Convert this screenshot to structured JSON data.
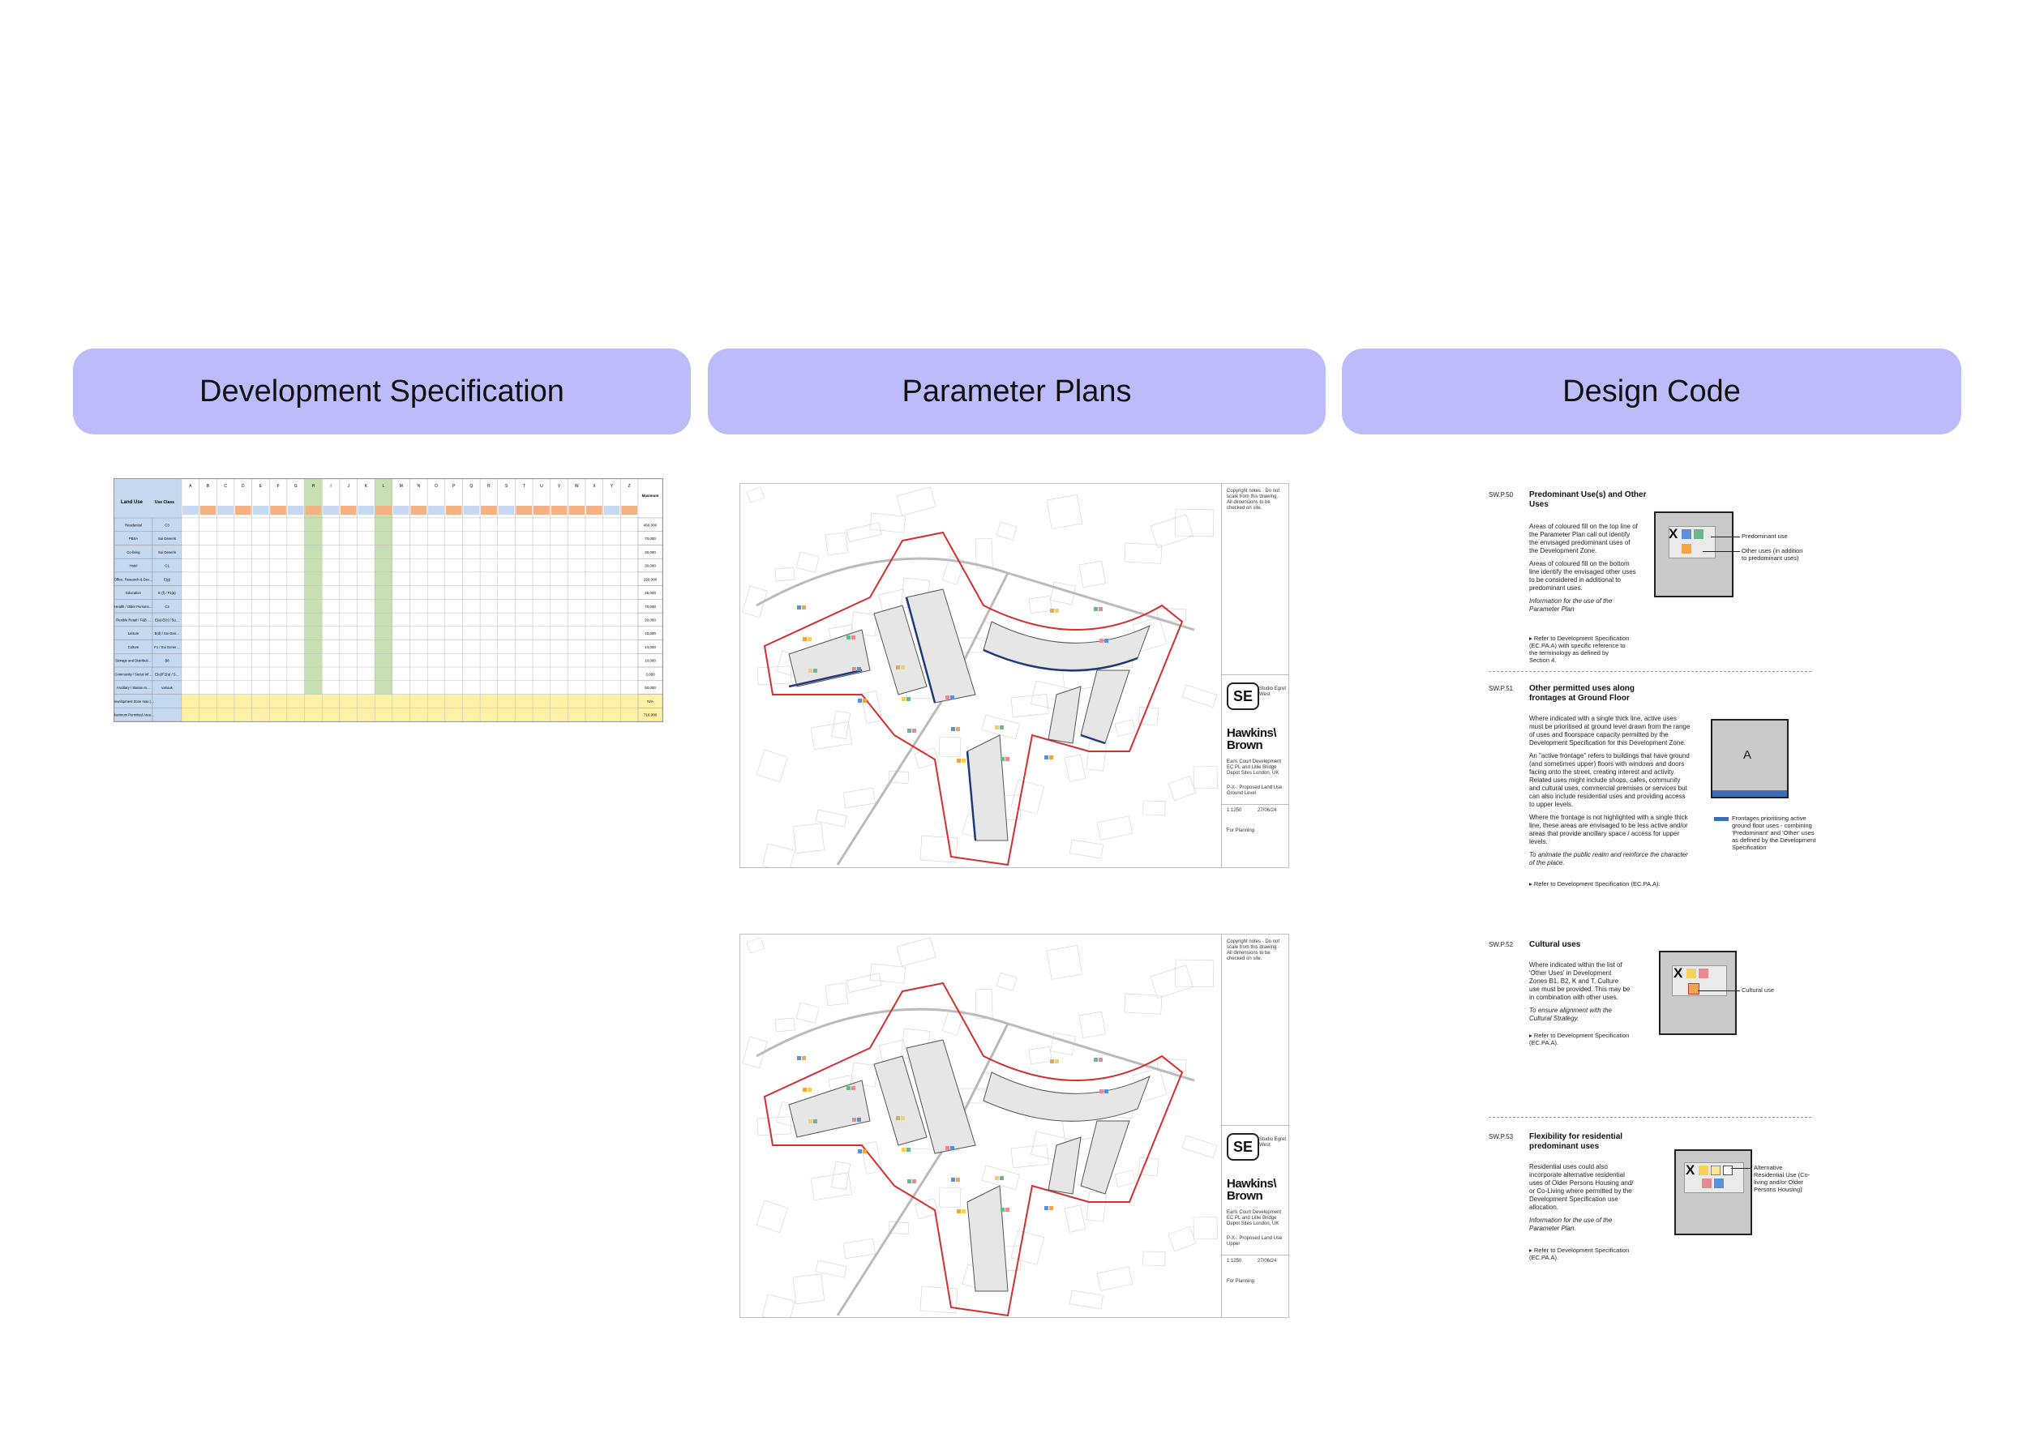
{
  "headers": {
    "development_specification": "Development Specification",
    "parameter_plans": "Parameter Plans",
    "design_code": "Design Code"
  },
  "spec_table": {
    "land_use_header": "Land Use",
    "use_class_header": "Use Class",
    "max_header": "Maximum Permitted Area (sqm GEA)",
    "zones": [
      "A",
      "B",
      "C",
      "D",
      "E",
      "F",
      "G",
      "H",
      "I",
      "J",
      "K",
      "L",
      "M",
      "N",
      "O",
      "P",
      "Q",
      "R",
      "S",
      "T",
      "U",
      "V",
      "W",
      "X",
      "Y",
      "Z"
    ],
    "rows": [
      {
        "use": "Residential",
        "cls": "C3",
        "max": "460,000"
      },
      {
        "use": "PBSA",
        "cls": "Sui Generis",
        "max": "70,000"
      },
      {
        "use": "Co-living",
        "cls": "Sui Generis",
        "max": "30,000"
      },
      {
        "use": "Hotel",
        "cls": "C1",
        "max": "30,000"
      },
      {
        "use": "Office, Research & Development",
        "cls": "E(g)",
        "max": "250,000"
      },
      {
        "use": "Education",
        "cls": "E (f) / F1(a)",
        "max": "45,000"
      },
      {
        "use": "Health / Older Persons Housing",
        "cls": "C2",
        "max": "70,000"
      },
      {
        "use": "Flexible Retail / F&B / Commercial",
        "cls": "E(a)-E(c) / Sui Generis",
        "max": "20,000"
      },
      {
        "use": "Leisure",
        "cls": "E(d) / Sui Generis",
        "max": "10,000"
      },
      {
        "use": "Culture",
        "cls": "F1 / Sui Generis",
        "max": "14,000"
      },
      {
        "use": "Storage and Distribution",
        "cls": "B8",
        "max": "10,000"
      },
      {
        "use": "Community / Social Infrastructure",
        "cls": "E(e)/F2(a) / Sui Generis",
        "max": "3,000"
      },
      {
        "use": "Ancillary / Station Interface / Plant / Parking / Servicing / Earth",
        "cls": "various",
        "max": "50,000"
      },
      {
        "use": "Development Zone max (sqm GEA)",
        "cls": "",
        "max": "N/A"
      },
      {
        "use": "Maximum Permitted Area (sqm GEA)",
        "cls": "",
        "max": "710,000"
      }
    ]
  },
  "plans": [
    {
      "brand": "Hawkins\\ Brown",
      "studio": "Studio Egret West",
      "project": "Earls Court Development EC PL and Lillie Bridge Depot Sites London, UK",
      "drawing": "P-X-: Proposed Land Use Ground Level",
      "scale": "1:1250",
      "date": "27/06/24",
      "status": "For Planning"
    },
    {
      "brand": "Hawkins\\ Brown",
      "studio": "Studio Egret West",
      "project": "Earls Court Development EC PL and Lillie Bridge Depot Sites London, UK",
      "drawing": "P-X-: Proposed Land Use Upper",
      "scale": "1:1250",
      "date": "27/06/24",
      "status": "For Planning"
    }
  ],
  "design_code": [
    {
      "code": "SW.P.50",
      "title": "Predominant Use(s) and Other Uses",
      "body": [
        "Areas of coloured fill on the top line of the Parameter Plan call out identify the envisaged predominant uses of the Development Zone.",
        "Areas of coloured fill on the bottom line identify the envisaged other uses to be considered in additional to predominant uses."
      ],
      "italic": "Information for the use of the Parameter Plan",
      "ref": "Refer to Development Specification (EC.PA.A) with specific reference to the terminology as defined by Section 4.",
      "notes": [
        "Predominant use",
        "Other uses (in addition to predominant uses)"
      ],
      "glyph": "X"
    },
    {
      "code": "SW.P.51",
      "title": "Other permitted uses along frontages at Ground Floor",
      "body": [
        "Where indicated with a single thick line, active uses must be prioritised at ground level drawn from the range of uses and floorspace capacity permitted by the Development Specification for this Development Zone.",
        "An \"active frontage\" refers to buildings that have ground (and sometimes upper) floors with windows and doors facing onto the street, creating interest and activity. Related uses might include shops, cafes, community and cultural uses, commercial premises or services but can also include residential uses and providing access to upper levels.",
        "Where the frontage is not highlighted with a single thick line, these areas are envisaged to be less active and/or areas that provide ancillary space / access for upper levels."
      ],
      "italic": "To animate the public realm and reinforce the character of the place.",
      "ref": "Refer to Development Specification (EC.PA.A).",
      "notes": [
        "Frontages prioritising active ground floor uses - combining 'Predominant' and 'Other' uses as defined by the Development Specification"
      ],
      "glyph": "A"
    },
    {
      "code": "SW.P.52",
      "title": "Cultural uses",
      "body": [
        "Where indicated within the list of 'Other Uses' in Development Zones B1, B2, K and T, Culture use must be provided. This may be in combination with other uses."
      ],
      "italic": "To ensure alignment with the Cultural Strategy.",
      "ref": "Refer to Development Specification (EC.PA.A).",
      "notes": [
        "Cultural use"
      ],
      "glyph": "X"
    },
    {
      "code": "SW.P.53",
      "title": "Flexibility for residential predominant uses",
      "body": [
        "Residential uses could also incorporate alternative residential uses of Older Persons Housing and/ or Co-Living where permitted by the Development Specification use allocation."
      ],
      "italic": "Information for the use of the Parameter Plan.",
      "ref": "Refer to Development Specification (EC.PA.A).",
      "notes": [
        "Alternative Residential Use (Co-living and/or Older Persons Housing)"
      ],
      "glyph": "X"
    }
  ],
  "colors": {
    "header_bg": "#bcbcfb",
    "table_blue": "#c6d9f1",
    "table_green": "#c6e0b4",
    "table_orange": "#f4b183",
    "table_yellow": "#fff2a8",
    "plan_red": "#d22f2f",
    "plan_navy": "#1f3a7a"
  }
}
